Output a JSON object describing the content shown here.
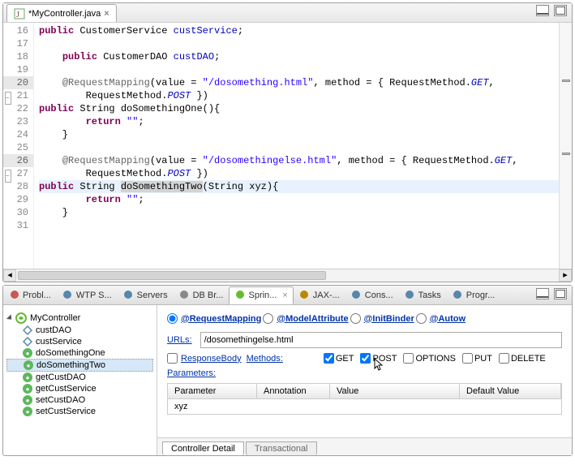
{
  "editor": {
    "tab_title": "*MyController.java",
    "lines": [
      {
        "n": 16,
        "html": "<span class='kw'>public</span> CustomerService <span class='fld'>custService</span>;"
      },
      {
        "n": 17,
        "html": ""
      },
      {
        "n": 18,
        "html": "    <span class='kw'>public</span> CustomerDAO <span class='fld'>custDAO</span>;"
      },
      {
        "n": 19,
        "html": ""
      },
      {
        "n": 20,
        "html": "    <span class='ann'>@RequestMapping</span>(value = <span class='str'>\"/dosomething.html\"</span>, method = { RequestMethod.<span class='static'>GET</span>,",
        "ann": true,
        "fold": true
      },
      {
        "n": 21,
        "html": "        RequestMethod.<span class='static'>POST</span> })"
      },
      {
        "n": 22,
        "html": "<span class='kw'>public</span> String doSomethingOne(){"
      },
      {
        "n": 23,
        "html": "        <span class='kw'>return</span> <span class='str'>\"\"</span>;"
      },
      {
        "n": 24,
        "html": "    }"
      },
      {
        "n": 25,
        "html": ""
      },
      {
        "n": 26,
        "html": "    <span class='ann'>@RequestMapping</span>(value = <span class='str'>\"/dosomethingelse.html\"</span>, method = { RequestMethod.<span class='static'>GET</span>,",
        "ann": true,
        "fold": true
      },
      {
        "n": 27,
        "html": "        RequestMethod.<span class='static'>POST</span> })"
      },
      {
        "n": 28,
        "html": "<span class='kw'>public</span> String <span style='background:#d4d4d4'>doSomethingTwo</span>(String xyz){",
        "hl": true,
        "stripe": true
      },
      {
        "n": 29,
        "html": "        <span class='kw'>return</span> <span class='str'>\"\"</span>;"
      },
      {
        "n": 30,
        "html": "    }"
      },
      {
        "n": 31,
        "html": ""
      }
    ]
  },
  "view_tabs": [
    {
      "label": "Probl...",
      "icon": "problem",
      "active": false
    },
    {
      "label": "WTP S...",
      "icon": "wtp",
      "active": false
    },
    {
      "label": "Servers",
      "icon": "server",
      "active": false
    },
    {
      "label": "DB Br...",
      "icon": "db",
      "active": false
    },
    {
      "label": "Sprin...",
      "icon": "spring",
      "active": true
    },
    {
      "label": "JAX-...",
      "icon": "jax",
      "active": false
    },
    {
      "label": "Cons...",
      "icon": "console",
      "active": false
    },
    {
      "label": "Tasks",
      "icon": "tasks",
      "active": false
    },
    {
      "label": "Progr...",
      "icon": "progress",
      "active": false
    }
  ],
  "tree": {
    "root": "MyController",
    "children": [
      {
        "label": "custDAO",
        "icon": "tri"
      },
      {
        "label": "custService",
        "icon": "tri"
      },
      {
        "label": "doSomethingOne",
        "icon": "green"
      },
      {
        "label": "doSomethingTwo",
        "icon": "green",
        "sel": true
      },
      {
        "label": "getCustDAO",
        "icon": "green"
      },
      {
        "label": "getCustService",
        "icon": "green"
      },
      {
        "label": "setCustDAO",
        "icon": "green"
      },
      {
        "label": "setCustService",
        "icon": "green"
      }
    ]
  },
  "detail": {
    "radios": [
      {
        "label": "@RequestMapping",
        "checked": true
      },
      {
        "label": "@ModelAttribute",
        "checked": false
      },
      {
        "label": "@InitBinder",
        "checked": false
      },
      {
        "label": "@Autow",
        "checked": false
      }
    ],
    "urls_label": "URLs:",
    "urls_value": "/dosomethingelse.html",
    "responsebody_label": "ResponseBody",
    "methods_label": "Methods:",
    "http_methods": [
      {
        "label": "GET",
        "checked": true
      },
      {
        "label": "POST",
        "checked": true
      },
      {
        "label": "OPTIONS",
        "checked": false
      },
      {
        "label": "PUT",
        "checked": false
      },
      {
        "label": "DELETE",
        "checked": false
      }
    ],
    "parameters_label": "Parameters:",
    "table_headers": {
      "param": "Parameter",
      "ann": "Annotation",
      "val": "Value",
      "def": "Default Value"
    },
    "table_rows": [
      {
        "param": "xyz",
        "ann": "",
        "val": "",
        "def": ""
      }
    ],
    "sub_tabs": [
      "Controller Detail",
      "Transactional"
    ]
  }
}
